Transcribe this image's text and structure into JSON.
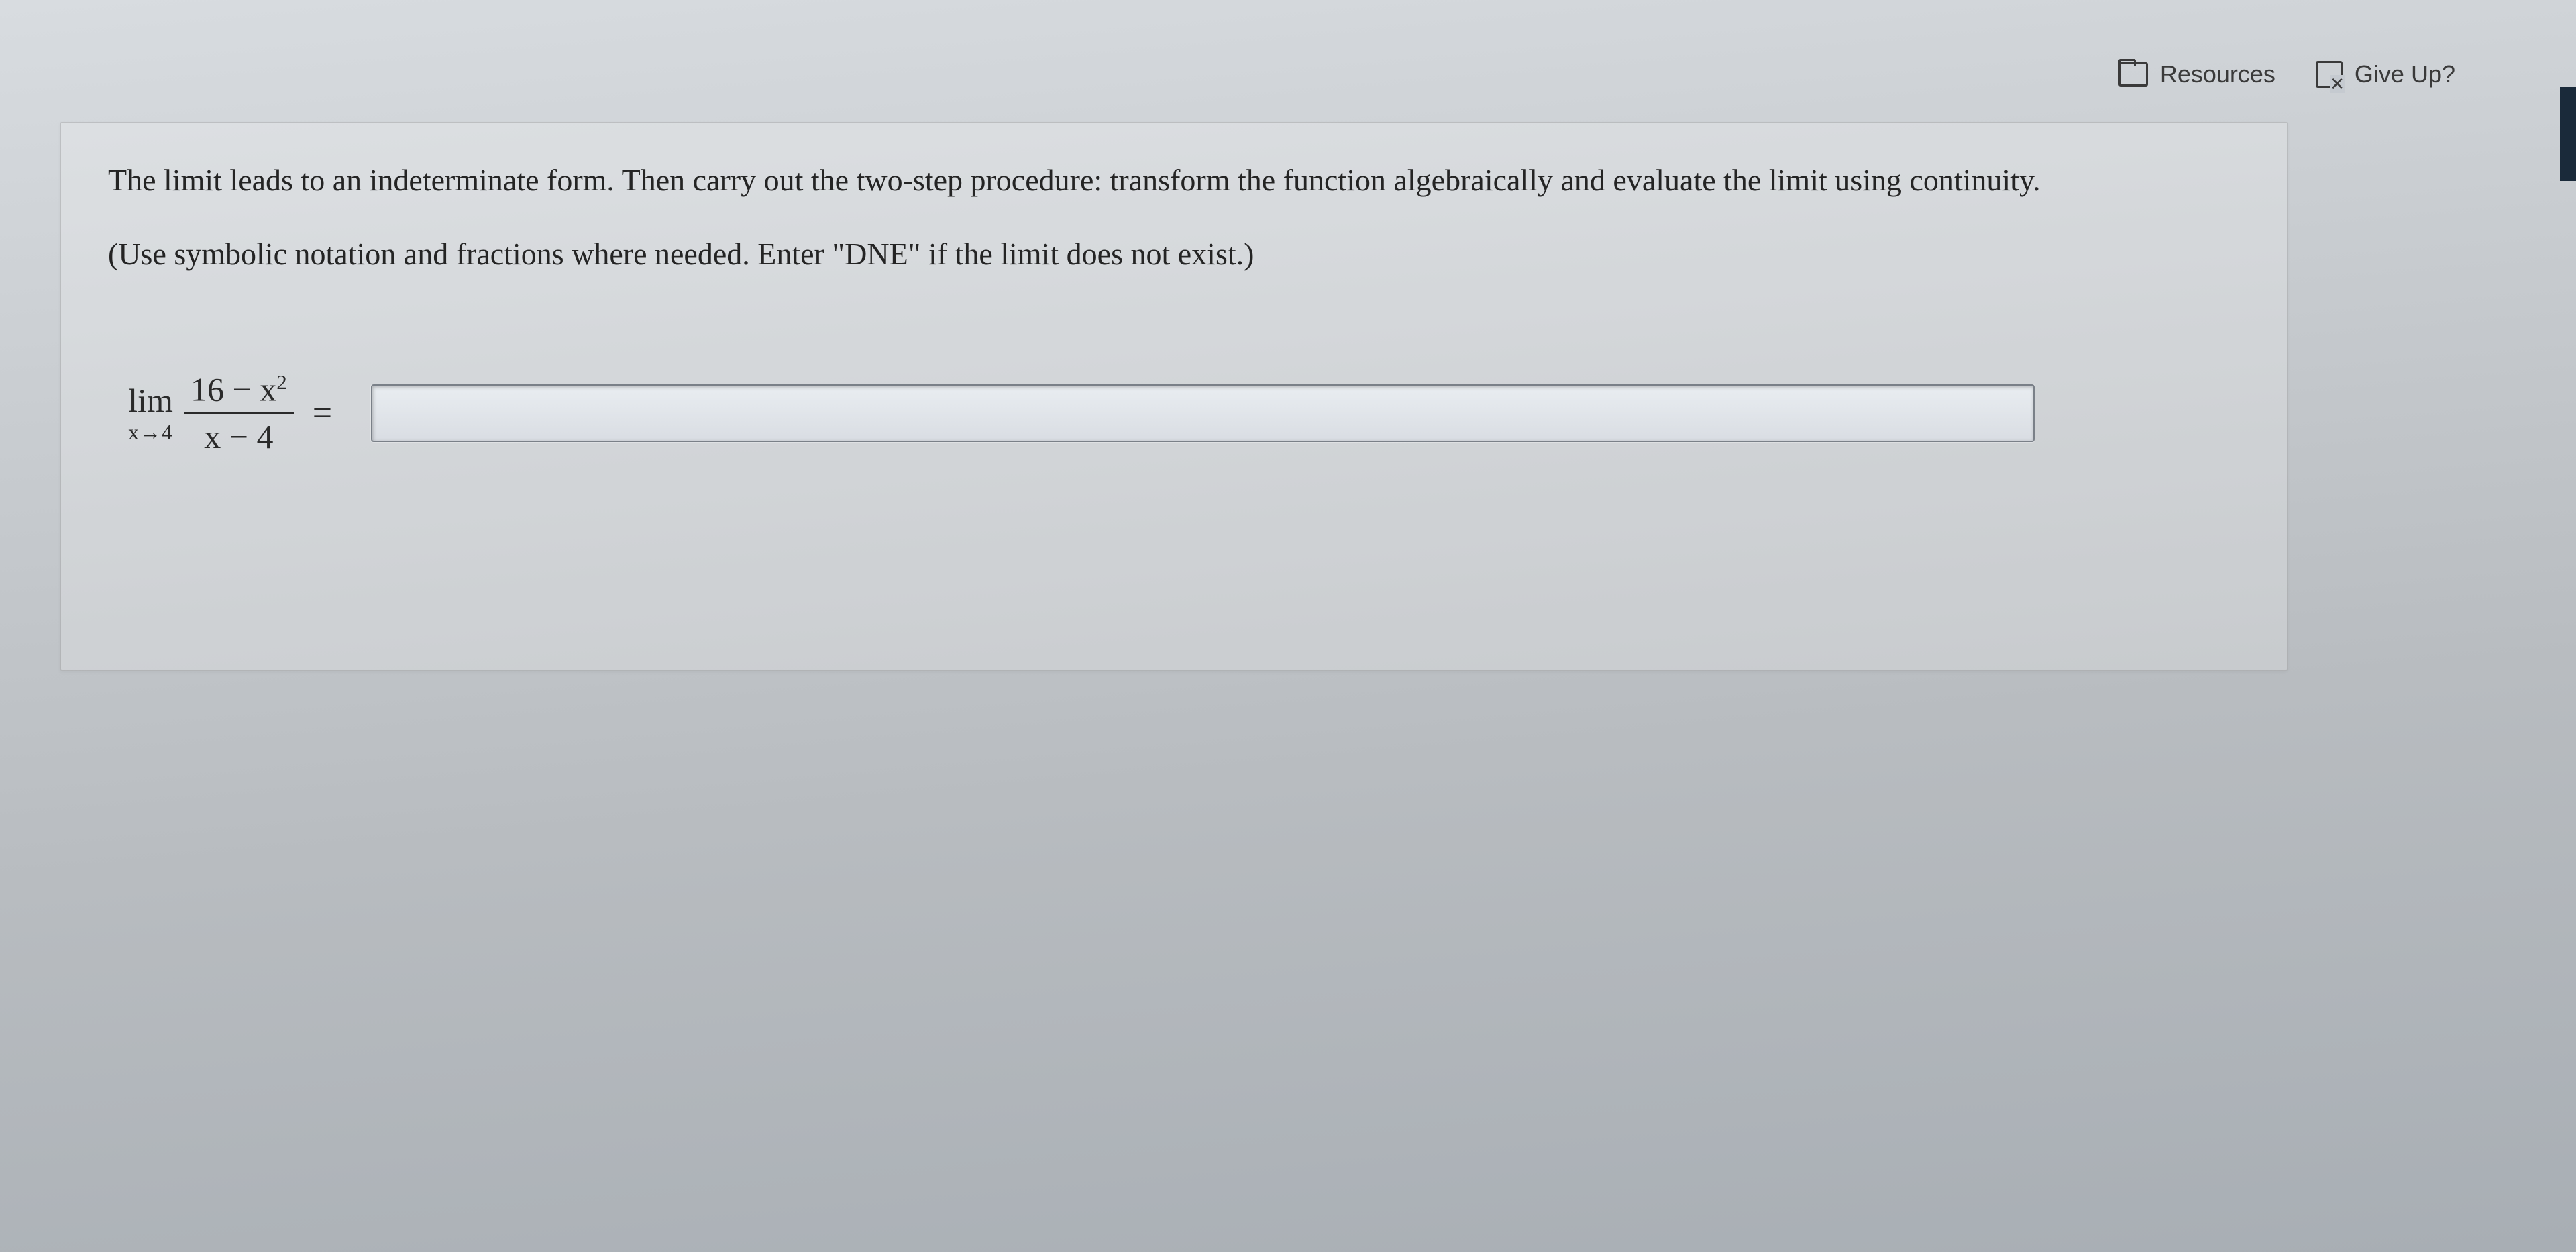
{
  "toolbar": {
    "resources_label": "Resources",
    "giveup_label": "Give Up?"
  },
  "question": {
    "instructions": "The limit leads to an indeterminate form. Then carry out the two-step procedure: transform the function algebraically and evaluate the limit using continuity.",
    "hint": "(Use symbolic notation and fractions where needed. Enter \"DNE\" if the limit does not exist.)",
    "limit": {
      "lim_label": "lim",
      "approach": "x→4",
      "numerator": "16 − x",
      "numerator_exp": "2",
      "denominator": "x − 4",
      "equals": "="
    },
    "answer_value": "",
    "answer_placeholder": ""
  }
}
